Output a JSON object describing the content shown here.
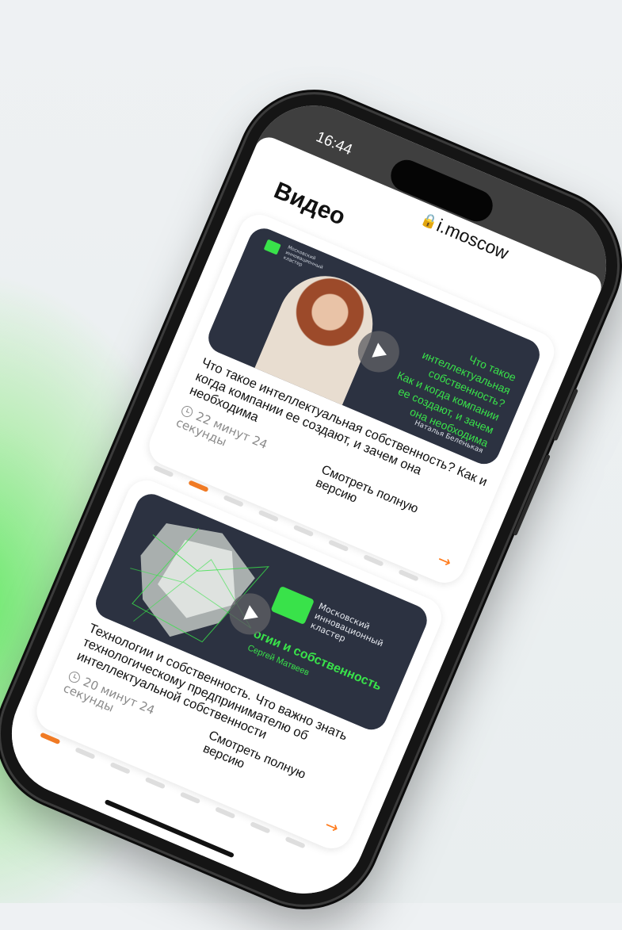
{
  "status_bar": {
    "time": "16:44"
  },
  "address_bar": {
    "url": "i.moscow"
  },
  "page": {
    "title": "Видео"
  },
  "videos": [
    {
      "thumb_brand": "Московский инновационный кластер",
      "thumb_lines": [
        "Что такое",
        "интеллектуальная",
        "собственность?",
        "Как и когда компании",
        "ее создают, и зачем",
        "она необходима"
      ],
      "thumb_speaker": "Наталья Беленькая",
      "title": "Что такое интеллектуальная собственность? Как и когда компании ее создают, и зачем она необходима",
      "duration": "22 минут 24 секунды",
      "watch_label": "Смотреть полную версию"
    },
    {
      "thumb_brand": "Московский инновационный кластер",
      "thumb_title": "огии и собственность",
      "thumb_speaker": "Сергей Матвеев",
      "title": "Технологии и собственность. Что важно знать технологическому предпринимателю об интеллектуальной собственности",
      "duration": "20 минут 24 секунды",
      "watch_label": "Смотреть полную версию"
    }
  ],
  "carousel": {
    "dot_count": 8,
    "active_color": "#f07a24",
    "inactive_color": "#dedede"
  },
  "colors": {
    "accent_green": "#39e24a",
    "accent_orange": "#ff7a1a",
    "thumb_bg": "#2c3241"
  },
  "icons": {
    "lock": "lock-icon",
    "play": "play-icon",
    "clock": "clock-icon",
    "arrow": "arrow-right-icon"
  }
}
